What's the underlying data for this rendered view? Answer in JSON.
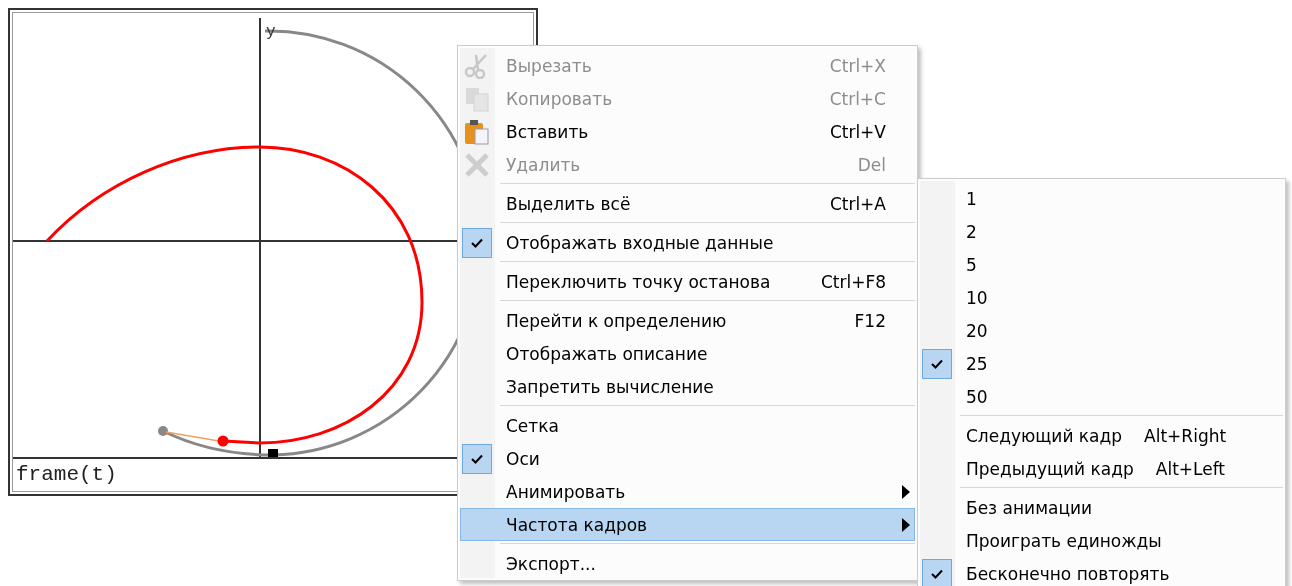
{
  "plot": {
    "axis_label": "y",
    "expression": "frame(t)"
  },
  "context_menu": {
    "items": [
      {
        "kind": "item",
        "label": "Вырезать",
        "shortcut": "Ctrl+X",
        "disabled": true,
        "checked": false,
        "submenu": false,
        "selected": false
      },
      {
        "kind": "item",
        "label": "Копировать",
        "shortcut": "Ctrl+C",
        "disabled": true,
        "checked": false,
        "submenu": false,
        "selected": false
      },
      {
        "kind": "item",
        "label": "Вставить",
        "shortcut": "Ctrl+V",
        "disabled": false,
        "checked": false,
        "submenu": false,
        "selected": false
      },
      {
        "kind": "item",
        "label": "Удалить",
        "shortcut": "Del",
        "disabled": true,
        "checked": false,
        "submenu": false,
        "selected": false
      },
      {
        "kind": "separator"
      },
      {
        "kind": "item",
        "label": "Выделить всё",
        "shortcut": "Ctrl+A",
        "disabled": false,
        "checked": false,
        "submenu": false,
        "selected": false
      },
      {
        "kind": "separator"
      },
      {
        "kind": "item",
        "label": "Отображать входные данные",
        "disabled": false,
        "checked": true,
        "submenu": false,
        "selected": false
      },
      {
        "kind": "separator"
      },
      {
        "kind": "item",
        "label": "Переключить точку останова",
        "shortcut": "Ctrl+F8",
        "disabled": false,
        "checked": false,
        "submenu": false,
        "selected": false
      },
      {
        "kind": "separator"
      },
      {
        "kind": "item",
        "label": "Перейти к определению",
        "shortcut": "F12",
        "disabled": false,
        "checked": false,
        "submenu": false,
        "selected": false
      },
      {
        "kind": "item",
        "label": "Отображать описание",
        "disabled": false,
        "checked": false,
        "submenu": false,
        "selected": false
      },
      {
        "kind": "item",
        "label": "Запретить вычисление",
        "disabled": false,
        "checked": false,
        "submenu": false,
        "selected": false
      },
      {
        "kind": "separator"
      },
      {
        "kind": "item",
        "label": "Сетка",
        "disabled": false,
        "checked": false,
        "submenu": false,
        "selected": false
      },
      {
        "kind": "item",
        "label": "Оси",
        "disabled": false,
        "checked": true,
        "submenu": false,
        "selected": false
      },
      {
        "kind": "item",
        "label": "Анимировать",
        "disabled": false,
        "checked": false,
        "submenu": true,
        "selected": false
      },
      {
        "kind": "item",
        "label": "Частота кадров",
        "disabled": false,
        "checked": false,
        "submenu": true,
        "selected": true
      },
      {
        "kind": "separator"
      },
      {
        "kind": "item",
        "label": "Экспорт...",
        "disabled": false,
        "checked": false,
        "submenu": false,
        "selected": false
      }
    ]
  },
  "submenu": {
    "items": [
      {
        "kind": "item",
        "label": "1",
        "checked": false
      },
      {
        "kind": "item",
        "label": "2",
        "checked": false
      },
      {
        "kind": "item",
        "label": "5",
        "checked": false
      },
      {
        "kind": "item",
        "label": "10",
        "checked": false
      },
      {
        "kind": "item",
        "label": "20",
        "checked": false
      },
      {
        "kind": "item",
        "label": "25",
        "checked": true
      },
      {
        "kind": "item",
        "label": "50",
        "checked": false
      },
      {
        "kind": "separator"
      },
      {
        "kind": "item",
        "label": "Следующий кадр",
        "shortcut": "Alt+Right",
        "checked": false
      },
      {
        "kind": "item",
        "label": "Предыдущий кадр",
        "shortcut": "Alt+Left",
        "checked": false
      },
      {
        "kind": "separator"
      },
      {
        "kind": "item",
        "label": "Без анимации",
        "checked": false
      },
      {
        "kind": "item",
        "label": "Проиграть единожды",
        "checked": false
      },
      {
        "kind": "item",
        "label": "Бесконечно повторять",
        "checked": true
      }
    ]
  }
}
